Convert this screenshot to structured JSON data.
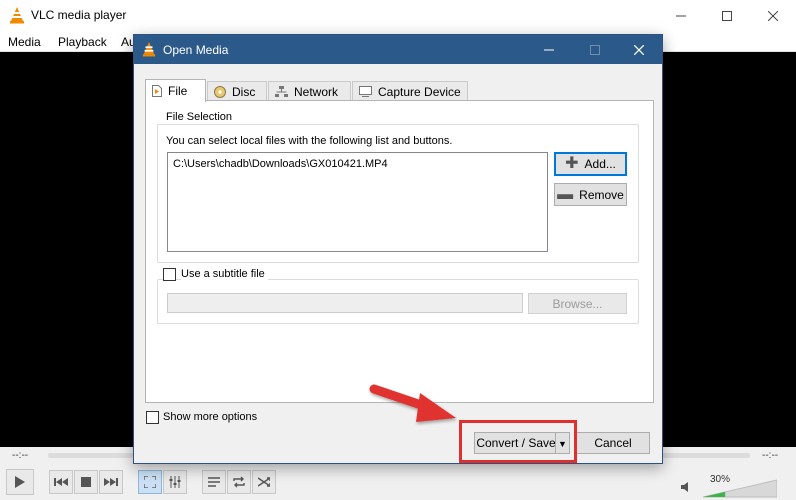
{
  "app": {
    "title": "VLC media player",
    "menu": [
      "Media",
      "Playback",
      "Au"
    ],
    "time_left": "--:--",
    "time_right": "--:--",
    "volume": "30%",
    "volume_level": 0.3
  },
  "dialog": {
    "title": "Open Media",
    "tabs": [
      {
        "label": "File",
        "icon": "file-icon"
      },
      {
        "label": "Disc",
        "icon": "disc-icon"
      },
      {
        "label": "Network",
        "icon": "network-icon"
      },
      {
        "label": "Capture Device",
        "icon": "capture-device-icon"
      }
    ],
    "file_selection": {
      "legend": "File Selection",
      "hint": "You can select local files with the following list and buttons.",
      "files": [
        "C:\\Users\\chadb\\Downloads\\GX010421.MP4"
      ],
      "add_label": "Add...",
      "remove_label": "Remove"
    },
    "subtitle": {
      "checkbox_label": "Use a subtitle file",
      "checked": false,
      "browse_label": "Browse..."
    },
    "show_more_options": {
      "label": "Show more options",
      "checked": false
    },
    "convert_save_label": "Convert / Save",
    "cancel_label": "Cancel"
  },
  "colors": {
    "dialog_title_bg": "#2b5a8a",
    "annotation_red": "#e0302d",
    "vlc_orange": "#f08a00"
  }
}
